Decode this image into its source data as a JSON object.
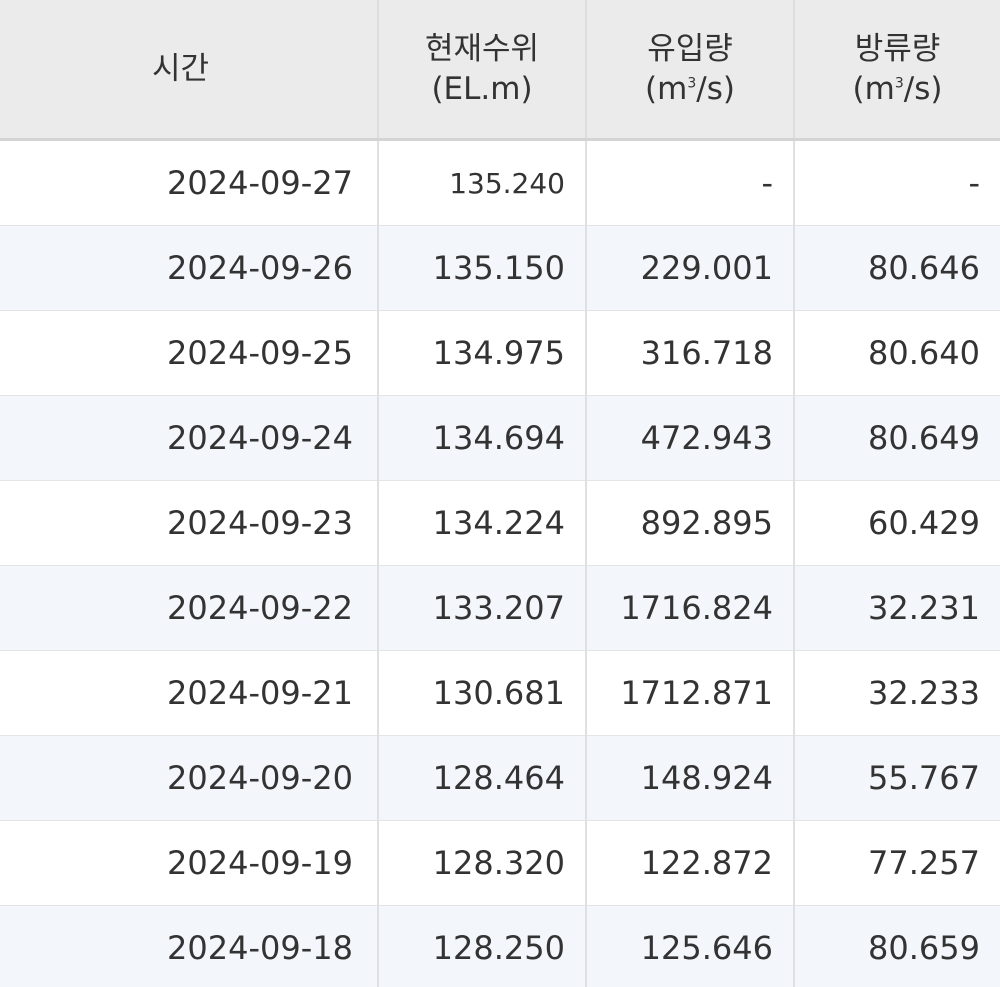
{
  "table": {
    "headers": {
      "time": "시간",
      "level_line1": "현재수위",
      "level_line2": "(EL.m)",
      "inflow_line1": "유입량",
      "inflow_unit_pre": "(m",
      "inflow_unit_sup": "3",
      "inflow_unit_post": "/s)",
      "outflow_line1": "방류량",
      "outflow_unit_pre": "(m",
      "outflow_unit_sup": "3",
      "outflow_unit_post": "/s)"
    },
    "rows": [
      {
        "date": "2024-09-27",
        "level": "135.240",
        "inflow": "-",
        "outflow": "-"
      },
      {
        "date": "2024-09-26",
        "level": "135.150",
        "inflow": "229.001",
        "outflow": "80.646"
      },
      {
        "date": "2024-09-25",
        "level": "134.975",
        "inflow": "316.718",
        "outflow": "80.640"
      },
      {
        "date": "2024-09-24",
        "level": "134.694",
        "inflow": "472.943",
        "outflow": "80.649"
      },
      {
        "date": "2024-09-23",
        "level": "134.224",
        "inflow": "892.895",
        "outflow": "60.429"
      },
      {
        "date": "2024-09-22",
        "level": "133.207",
        "inflow": "1716.824",
        "outflow": "32.231"
      },
      {
        "date": "2024-09-21",
        "level": "130.681",
        "inflow": "1712.871",
        "outflow": "32.233"
      },
      {
        "date": "2024-09-20",
        "level": "128.464",
        "inflow": "148.924",
        "outflow": "55.767"
      },
      {
        "date": "2024-09-19",
        "level": "128.320",
        "inflow": "122.872",
        "outflow": "77.257"
      },
      {
        "date": "2024-09-18",
        "level": "128.250",
        "inflow": "125.646",
        "outflow": "80.659"
      }
    ]
  }
}
